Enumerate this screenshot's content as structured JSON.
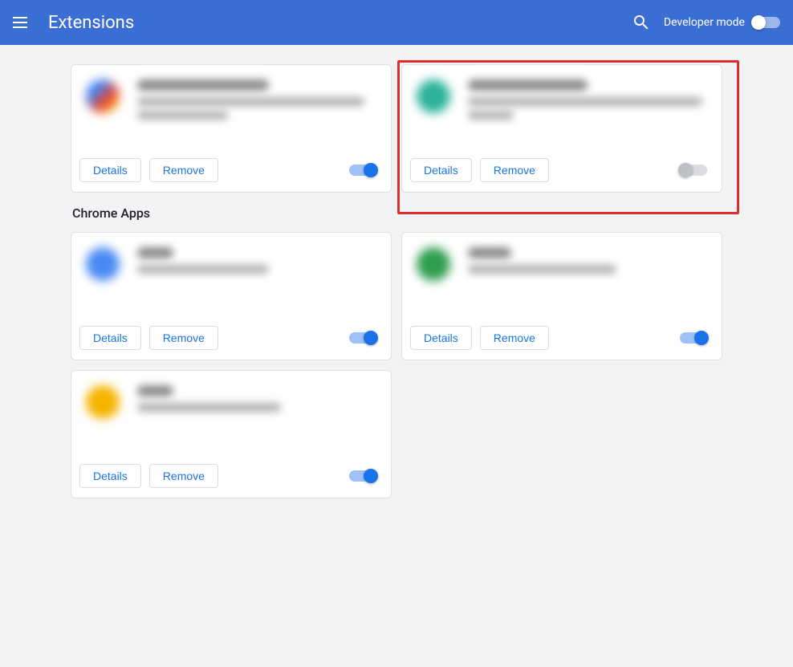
{
  "header": {
    "title": "Extensions",
    "dev_mode_label": "Developer mode",
    "dev_mode_on": false
  },
  "sections": {
    "apps_title": "Chrome Apps"
  },
  "buttons": {
    "details": "Details",
    "remove": "Remove"
  },
  "extensions": [
    {
      "icon_color": "linear-gradient(135deg,#4285f4 30%,#ea4335 60%,#fbbc05 90%)",
      "title_w": 55,
      "desc_w": [
        95,
        38
      ],
      "enabled": true,
      "highlighted": false
    },
    {
      "icon_color": "#2bb39b",
      "title_w": 50,
      "desc_w": [
        98,
        19
      ],
      "enabled": false,
      "highlighted": true
    }
  ],
  "apps": [
    {
      "icon_color": "#4a8af4",
      "title_w": 15,
      "desc_w": [
        55
      ],
      "enabled": true
    },
    {
      "icon_color": "#2e9e4d",
      "title_w": 18,
      "desc_w": [
        62
      ],
      "enabled": true
    },
    {
      "icon_color": "#f4b400",
      "title_w": 15,
      "desc_w": [
        60
      ],
      "enabled": true
    }
  ]
}
